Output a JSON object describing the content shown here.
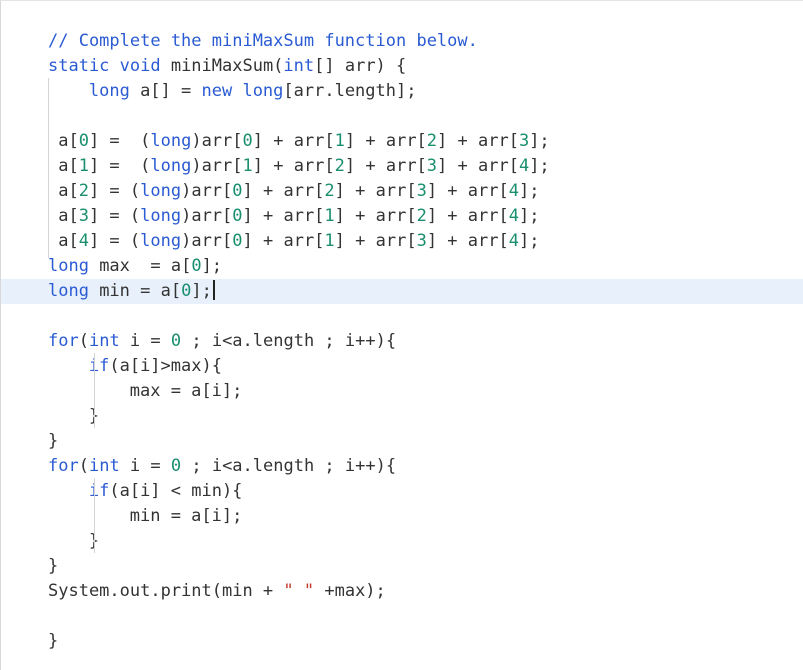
{
  "editor": {
    "lines": [
      {
        "indent": 0,
        "tokens": [
          {
            "t": "// Complete the miniMaxSum function below.",
            "c": "cm"
          }
        ]
      },
      {
        "indent": 0,
        "tokens": [
          {
            "t": "static void",
            "c": "kw"
          },
          {
            "t": " miniMaxSum("
          },
          {
            "t": "int",
            "c": "kw"
          },
          {
            "t": "[] arr) {"
          }
        ]
      },
      {
        "indent": 4,
        "tokens": [
          {
            "t": "long",
            "c": "kw"
          },
          {
            "t": " a[] = "
          },
          {
            "t": "new",
            "c": "kw"
          },
          {
            "t": " "
          },
          {
            "t": "long",
            "c": "kw"
          },
          {
            "t": "[arr.length];"
          }
        ]
      },
      {
        "indent": 0,
        "tokens": []
      },
      {
        "indent": 1,
        "tokens": [
          {
            "t": "a["
          },
          {
            "t": "0",
            "c": "num"
          },
          {
            "t": "] =  ("
          },
          {
            "t": "long",
            "c": "kw"
          },
          {
            "t": ")arr["
          },
          {
            "t": "0",
            "c": "num"
          },
          {
            "t": "] + arr["
          },
          {
            "t": "1",
            "c": "num"
          },
          {
            "t": "] + arr["
          },
          {
            "t": "2",
            "c": "num"
          },
          {
            "t": "] + arr["
          },
          {
            "t": "3",
            "c": "num"
          },
          {
            "t": "];"
          }
        ]
      },
      {
        "indent": 1,
        "tokens": [
          {
            "t": "a["
          },
          {
            "t": "1",
            "c": "num"
          },
          {
            "t": "] =  ("
          },
          {
            "t": "long",
            "c": "kw"
          },
          {
            "t": ")arr["
          },
          {
            "t": "1",
            "c": "num"
          },
          {
            "t": "] + arr["
          },
          {
            "t": "2",
            "c": "num"
          },
          {
            "t": "] + arr["
          },
          {
            "t": "3",
            "c": "num"
          },
          {
            "t": "] + arr["
          },
          {
            "t": "4",
            "c": "num"
          },
          {
            "t": "];"
          }
        ]
      },
      {
        "indent": 1,
        "tokens": [
          {
            "t": "a["
          },
          {
            "t": "2",
            "c": "num"
          },
          {
            "t": "] = ("
          },
          {
            "t": "long",
            "c": "kw"
          },
          {
            "t": ")arr["
          },
          {
            "t": "0",
            "c": "num"
          },
          {
            "t": "] + arr["
          },
          {
            "t": "2",
            "c": "num"
          },
          {
            "t": "] + arr["
          },
          {
            "t": "3",
            "c": "num"
          },
          {
            "t": "] + arr["
          },
          {
            "t": "4",
            "c": "num"
          },
          {
            "t": "];"
          }
        ]
      },
      {
        "indent": 1,
        "tokens": [
          {
            "t": "a["
          },
          {
            "t": "3",
            "c": "num"
          },
          {
            "t": "] = ("
          },
          {
            "t": "long",
            "c": "kw"
          },
          {
            "t": ")arr["
          },
          {
            "t": "0",
            "c": "num"
          },
          {
            "t": "] + arr["
          },
          {
            "t": "1",
            "c": "num"
          },
          {
            "t": "] + arr["
          },
          {
            "t": "2",
            "c": "num"
          },
          {
            "t": "] + arr["
          },
          {
            "t": "4",
            "c": "num"
          },
          {
            "t": "];"
          }
        ]
      },
      {
        "indent": 1,
        "tokens": [
          {
            "t": "a["
          },
          {
            "t": "4",
            "c": "num"
          },
          {
            "t": "] = ("
          },
          {
            "t": "long",
            "c": "kw"
          },
          {
            "t": ")arr["
          },
          {
            "t": "0",
            "c": "num"
          },
          {
            "t": "] + arr["
          },
          {
            "t": "1",
            "c": "num"
          },
          {
            "t": "] + arr["
          },
          {
            "t": "3",
            "c": "num"
          },
          {
            "t": "] + arr["
          },
          {
            "t": "4",
            "c": "num"
          },
          {
            "t": "];"
          }
        ]
      },
      {
        "indent": 0,
        "tokens": [
          {
            "t": "long",
            "c": "kw"
          },
          {
            "t": " max  = a["
          },
          {
            "t": "0",
            "c": "num"
          },
          {
            "t": "];"
          }
        ]
      },
      {
        "indent": 0,
        "active": true,
        "cursor": true,
        "tokens": [
          {
            "t": "long",
            "c": "kw"
          },
          {
            "t": " min = a["
          },
          {
            "t": "0",
            "c": "num"
          },
          {
            "t": "];"
          }
        ]
      },
      {
        "indent": 0,
        "tokens": []
      },
      {
        "indent": 0,
        "tokens": [
          {
            "t": "for",
            "c": "kw"
          },
          {
            "t": "("
          },
          {
            "t": "int",
            "c": "kw"
          },
          {
            "t": " i = "
          },
          {
            "t": "0",
            "c": "num"
          },
          {
            "t": " ; i<a.length ; i++){"
          }
        ]
      },
      {
        "indent": 4,
        "tokens": [
          {
            "t": "if",
            "c": "kw"
          },
          {
            "t": "(a[i]>max){"
          }
        ]
      },
      {
        "indent": 8,
        "tokens": [
          {
            "t": "max = a[i];"
          }
        ]
      },
      {
        "indent": 4,
        "tokens": [
          {
            "t": "}"
          }
        ]
      },
      {
        "indent": 0,
        "tokens": [
          {
            "t": "}"
          }
        ]
      },
      {
        "indent": 0,
        "tokens": [
          {
            "t": "for",
            "c": "kw"
          },
          {
            "t": "("
          },
          {
            "t": "int",
            "c": "kw"
          },
          {
            "t": " i = "
          },
          {
            "t": "0",
            "c": "num"
          },
          {
            "t": " ; i<a.length ; i++){"
          }
        ]
      },
      {
        "indent": 4,
        "tokens": [
          {
            "t": "if",
            "c": "kw"
          },
          {
            "t": "(a[i] < min){"
          }
        ]
      },
      {
        "indent": 8,
        "tokens": [
          {
            "t": "min = a[i];"
          }
        ]
      },
      {
        "indent": 4,
        "tokens": [
          {
            "t": "}"
          }
        ]
      },
      {
        "indent": 0,
        "tokens": [
          {
            "t": "}"
          }
        ]
      },
      {
        "indent": 0,
        "tokens": [
          {
            "t": "System.out.print(min + "
          },
          {
            "t": "\" \"",
            "c": "str"
          },
          {
            "t": " +max);"
          }
        ]
      },
      {
        "indent": 0,
        "tokens": []
      },
      {
        "indent": 0,
        "tokens": [
          {
            "t": "}"
          }
        ]
      }
    ],
    "colors": {
      "keyword": "#2a5bd3",
      "number": "#1a8f6f",
      "comment": "#2a5bd3",
      "string": "#c0392b",
      "text": "#333333",
      "active_line": "#e8f0fb"
    }
  }
}
